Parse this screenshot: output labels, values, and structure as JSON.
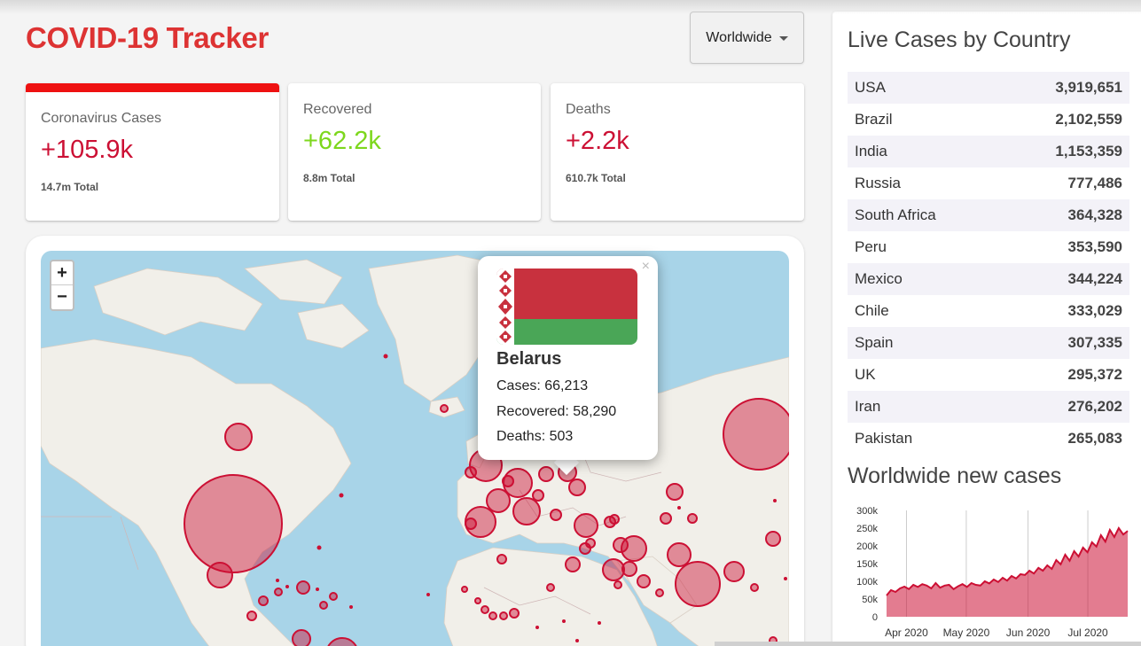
{
  "app": {
    "title": "COVID-19 Tracker",
    "selected_country": "Worldwide"
  },
  "stats": [
    {
      "title": "Coronavirus Cases",
      "value": "+105.9k",
      "total": "14.7m Total",
      "selected": true,
      "color": "#cc1034"
    },
    {
      "title": "Recovered",
      "value": "+62.2k",
      "total": "8.8m Total",
      "selected": false,
      "color": "#7dd71d"
    },
    {
      "title": "Deaths",
      "value": "+2.2k",
      "total": "610.7k Total",
      "selected": false,
      "color": "#cc1034"
    }
  ],
  "map": {
    "zoom_in": "+",
    "zoom_out": "−",
    "popup": {
      "close": "×",
      "country": "Belarus",
      "cases": "Cases: 66,213",
      "recovered": "Recovered: 58,290",
      "deaths": "Deaths: 503"
    }
  },
  "sidebar": {
    "title": "Live Cases by Country",
    "countries": [
      {
        "name": "USA",
        "cases": "3,919,651"
      },
      {
        "name": "Brazil",
        "cases": "2,102,559"
      },
      {
        "name": "India",
        "cases": "1,153,359"
      },
      {
        "name": "Russia",
        "cases": "777,486"
      },
      {
        "name": "South Africa",
        "cases": "364,328"
      },
      {
        "name": "Peru",
        "cases": "353,590"
      },
      {
        "name": "Mexico",
        "cases": "344,224"
      },
      {
        "name": "Chile",
        "cases": "333,029"
      },
      {
        "name": "Spain",
        "cases": "307,335"
      },
      {
        "name": "UK",
        "cases": "295,372"
      },
      {
        "name": "Iran",
        "cases": "276,202"
      },
      {
        "name": "Pakistan",
        "cases": "265,083"
      }
    ],
    "chart_title": "Worldwide new cases"
  },
  "chart_data": {
    "type": "area",
    "title": "Worldwide new cases",
    "x_ticks": [
      "Apr 2020",
      "May 2020",
      "Jun 2020",
      "Jul 2020"
    ],
    "y_ticks": [
      "0",
      "50k",
      "100k",
      "150k",
      "200k",
      "250k",
      "300k"
    ],
    "ylim": [
      0,
      300000
    ],
    "x_start": "2020-03-22",
    "x_end": "2020-07-21",
    "tick_dates": [
      "2020-04-01",
      "2020-05-01",
      "2020-06-01",
      "2020-07-01"
    ],
    "color": "#cc1034",
    "series": [
      {
        "values": [
          60000,
          75000,
          70000,
          80000,
          85000,
          78000,
          90000,
          84000,
          92000,
          88000,
          80000,
          95000,
          82000,
          88000,
          90000,
          78000,
          86000,
          92000,
          84000,
          95000,
          90000,
          88000,
          100000,
          94000,
          105000,
          98000,
          110000,
          102000,
          115000,
          108000,
          120000,
          118000,
          130000,
          122000,
          138000,
          130000,
          145000,
          135000,
          160000,
          148000,
          175000,
          158000,
          185000,
          170000,
          195000,
          182000,
          210000,
          198000,
          230000,
          212000,
          245000,
          225000,
          250000,
          232000,
          242000
        ]
      }
    ]
  }
}
